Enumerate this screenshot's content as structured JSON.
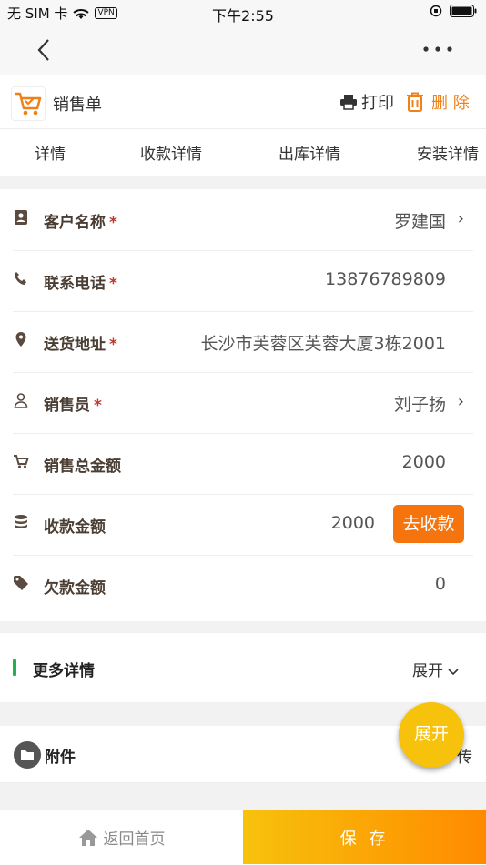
{
  "status_bar": {
    "carrier": "无 SIM 卡",
    "vpn": "VPN",
    "time": "下午2:55"
  },
  "nav": {
    "back_icon": "chevron-left-icon",
    "more_icon": "ellipsis-icon"
  },
  "header": {
    "title": "销售单",
    "print_label": "打印",
    "delete_label": "删 除",
    "accent": "#f08018"
  },
  "tabs": [
    "详情",
    "收款详情",
    "出库详情",
    "安装详情"
  ],
  "form": {
    "customer": {
      "label": "客户名称",
      "required": "*",
      "value": "罗建国"
    },
    "phone": {
      "label": "联系电话",
      "required": "*",
      "value": "13876789809"
    },
    "address": {
      "label": "送货地址",
      "required": "*",
      "value": "长沙市芙蓉区芙蓉大厦3栋2001"
    },
    "salesperson": {
      "label": "销售员",
      "required": "*",
      "value": "刘子扬"
    },
    "total": {
      "label": "销售总金额",
      "value": "2000"
    },
    "received": {
      "label": "收款金额",
      "value": "2000",
      "button": "去收款"
    },
    "owed": {
      "label": "欠款金额",
      "value": "0"
    }
  },
  "more": {
    "title": "更多详情",
    "expand_label": "展开"
  },
  "attachment": {
    "label": "附件",
    "action_partial": "传"
  },
  "fab_label": "展开",
  "bottom": {
    "home_label": "返回首页",
    "save_label": "保 存"
  }
}
